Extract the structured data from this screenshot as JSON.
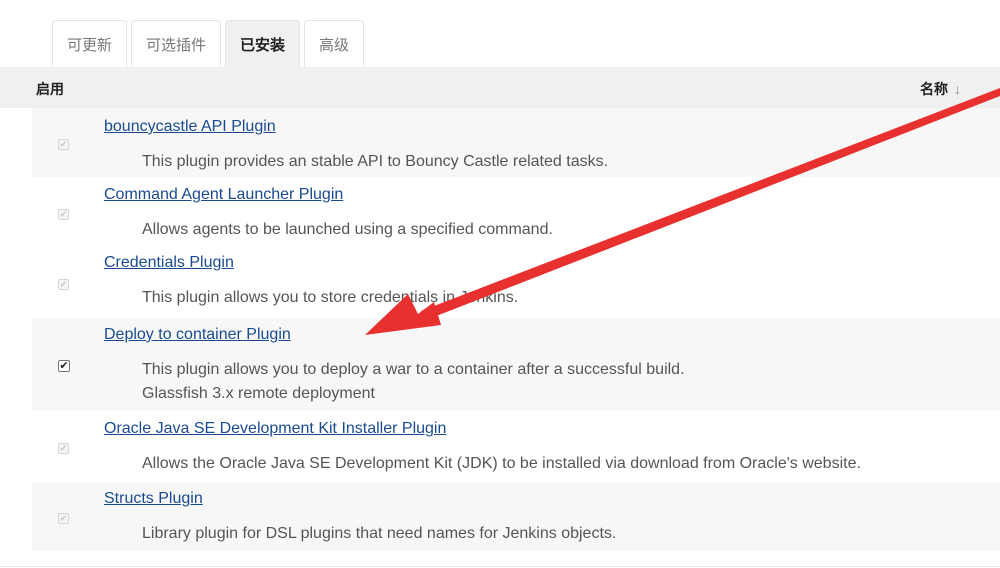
{
  "tabs": [
    {
      "label": "可更新",
      "active": false
    },
    {
      "label": "可选插件",
      "active": false
    },
    {
      "label": "已安装",
      "active": true
    },
    {
      "label": "高级",
      "active": false
    }
  ],
  "table": {
    "header_enabled": "启用",
    "header_name": "名称",
    "sort_indicator": "↓"
  },
  "plugins": [
    {
      "name": "bouncycastle API Plugin",
      "description": "This plugin provides an stable API to Bouncy Castle related tasks.",
      "enabled": true,
      "editable": false
    },
    {
      "name": "Command Agent Launcher Plugin",
      "description": "Allows agents to be launched using a specified command.",
      "enabled": true,
      "editable": false
    },
    {
      "name": "Credentials Plugin",
      "description": "This plugin allows you to store credentials in Jenkins.",
      "enabled": true,
      "editable": false
    },
    {
      "name": "Deploy to container Plugin",
      "description": "This plugin allows you to deploy a war to a container after a successful build.",
      "description_line2": "Glassfish 3.x remote deployment",
      "enabled": true,
      "editable": true
    },
    {
      "name": "Oracle Java SE Development Kit Installer Plugin",
      "description": "Allows the Oracle Java SE Development Kit (JDK) to be installed via download from Oracle's website.",
      "enabled": true,
      "editable": false
    },
    {
      "name": "Structs Plugin",
      "description": "Library plugin for DSL plugins that need names for Jenkins objects.",
      "enabled": true,
      "editable": false
    }
  ],
  "annotation": {
    "color": "#e8312f"
  }
}
